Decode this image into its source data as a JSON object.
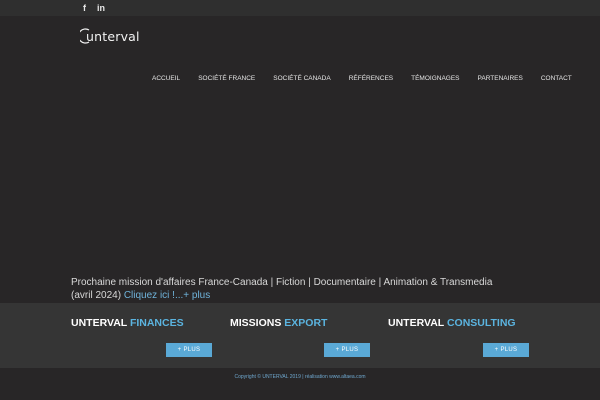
{
  "topbar": {
    "social": [
      {
        "icon": "facebook-icon",
        "glyph": "f"
      },
      {
        "icon": "linkedin-icon",
        "glyph": "in"
      }
    ]
  },
  "brand": {
    "logo_text": "unterval"
  },
  "nav": {
    "items": [
      "ACCUEIL",
      "SOCIÉTÉ FRANCE",
      "SOCIÉTÉ CANADA",
      "RÉFÉRENCES",
      "TÉMOIGNAGES",
      "PARTENAIRES",
      "CONTACT"
    ]
  },
  "announcement": {
    "text": "Prochaine mission d'affaires France-Canada | Fiction | Documentaire | Animation & Transmedia (avril 2024)",
    "link_label": "Cliquez ici !...+ plus"
  },
  "services": [
    {
      "title_main": "UNTERVAL",
      "title_accent": "FINANCES",
      "button_label": "+ PLUS"
    },
    {
      "title_main": "MISSIONS",
      "title_accent": "EXPORT",
      "button_label": "+ PLUS"
    },
    {
      "title_main": "UNTERVAL",
      "title_accent": "CONSULTING",
      "button_label": "+ PLUS"
    }
  ],
  "footer": {
    "copyright": "Copyright © UNTERVAL 2019 | réalisation www.altaea.com"
  },
  "colors": {
    "accent": "#5bb4e0",
    "button": "#5aa9d6",
    "background": "#282627"
  }
}
